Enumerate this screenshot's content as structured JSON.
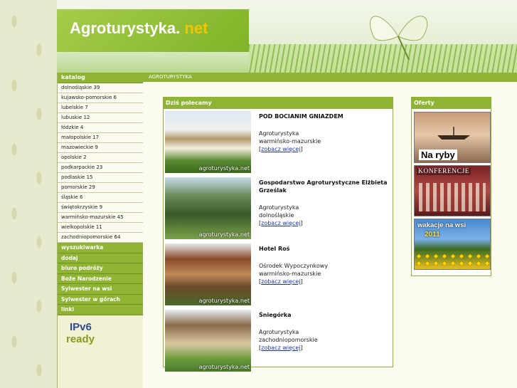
{
  "header": {
    "logo_main": "Agroturystyka.",
    "logo_tld": " net"
  },
  "leftnav": {
    "heading": "katalog",
    "regions": [
      "dolnośląskie 39",
      "kujawsko-pomorskie 6",
      "lubelskie 7",
      "lubuskie 12",
      "łódzkie 4",
      "małopolskie 17",
      "mazowieckie 9",
      "opolskie 2",
      "podkarpackie 23",
      "podlaskie 15",
      "pomorskie 29",
      "śląskie 6",
      "świętokrzyskie 9",
      "warmińsko-mazurskie 45",
      "wielkopolskie 11",
      "zachodniopomorskie 64"
    ],
    "sections": [
      "wyszukiwarka",
      "dodaj",
      "biuro podróży",
      "Boże Narodzenie",
      "Sylwester na wsi",
      "Sylwester w górach",
      "linki"
    ],
    "badge_line1": "IPv6",
    "badge_line2": "ready"
  },
  "breadcrumb": "AGROTURYSTYKA",
  "recommend": {
    "heading": "Dziś polecamy",
    "watermark": "agroturystyka.net",
    "more_label": "zobacz więcej",
    "items": [
      {
        "title": "POD BOCIANIM GNIAZDEM",
        "type": "Agroturystyka",
        "region": "warmińsko-mazurskie"
      },
      {
        "title": "Gospodarstwo Agroturystyczne Elżbieta Grześlak",
        "type": "Agroturystyka",
        "region": "dolnośląskie"
      },
      {
        "title": "Hotel Roś",
        "type": "Ośrodek Wypoczynkowy",
        "region": "warmińsko-mazurskie"
      },
      {
        "title": "Śniegórka",
        "type": "Agroturystyka",
        "region": "zachodniopomorskie"
      }
    ]
  },
  "offers": {
    "heading": "Oferty",
    "banners": [
      {
        "label": "Na ryby"
      },
      {
        "label": "KONFERENCJE"
      },
      {
        "label": "wakacje na wsi",
        "sub": "2011"
      }
    ]
  }
}
